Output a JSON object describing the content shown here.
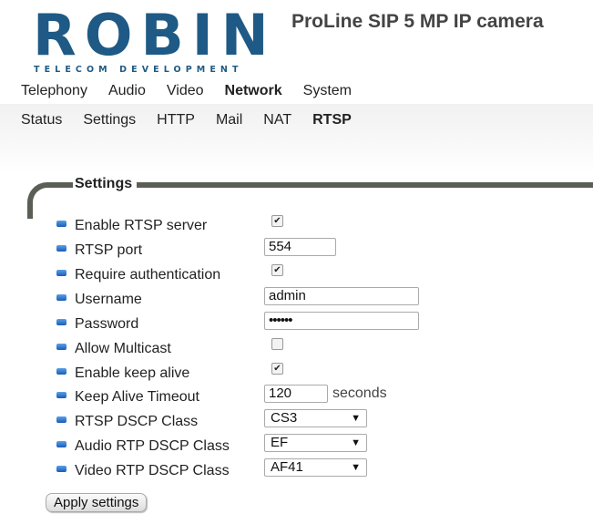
{
  "header": {
    "logo_text": "ROBIN",
    "logo_subtitle": "TELECOM DEVELOPMENT",
    "product_title": "ProLine SIP 5 MP IP camera",
    "brand_color": "#1e5a85"
  },
  "main_nav": {
    "items": [
      "Telephony",
      "Audio",
      "Video",
      "Network",
      "System"
    ],
    "active": "Network"
  },
  "sub_nav": {
    "items": [
      "Status",
      "Settings",
      "HTTP",
      "Mail",
      "NAT",
      "RTSP"
    ],
    "active": "RTSP"
  },
  "settings": {
    "legend": "Settings",
    "fields": {
      "enable_rtsp": {
        "label": "Enable RTSP server",
        "checked": true
      },
      "rtsp_port": {
        "label": "RTSP port",
        "value": "554"
      },
      "require_auth": {
        "label": "Require authentication",
        "checked": true
      },
      "username": {
        "label": "Username",
        "value": "admin"
      },
      "password": {
        "label": "Password",
        "value": "••••••"
      },
      "allow_multicast": {
        "label": "Allow Multicast",
        "checked": false
      },
      "keep_alive": {
        "label": "Enable keep alive",
        "checked": true
      },
      "keep_alive_timeout": {
        "label": "Keep Alive Timeout",
        "value": "120",
        "unit": "seconds"
      },
      "rtsp_dscp": {
        "label": "RTSP DSCP Class",
        "value": "CS3"
      },
      "audio_dscp": {
        "label": "Audio RTP DSCP Class",
        "value": "EF"
      },
      "video_dscp": {
        "label": "Video RTP DSCP Class",
        "value": "AF41"
      }
    },
    "apply_label": "Apply settings"
  }
}
